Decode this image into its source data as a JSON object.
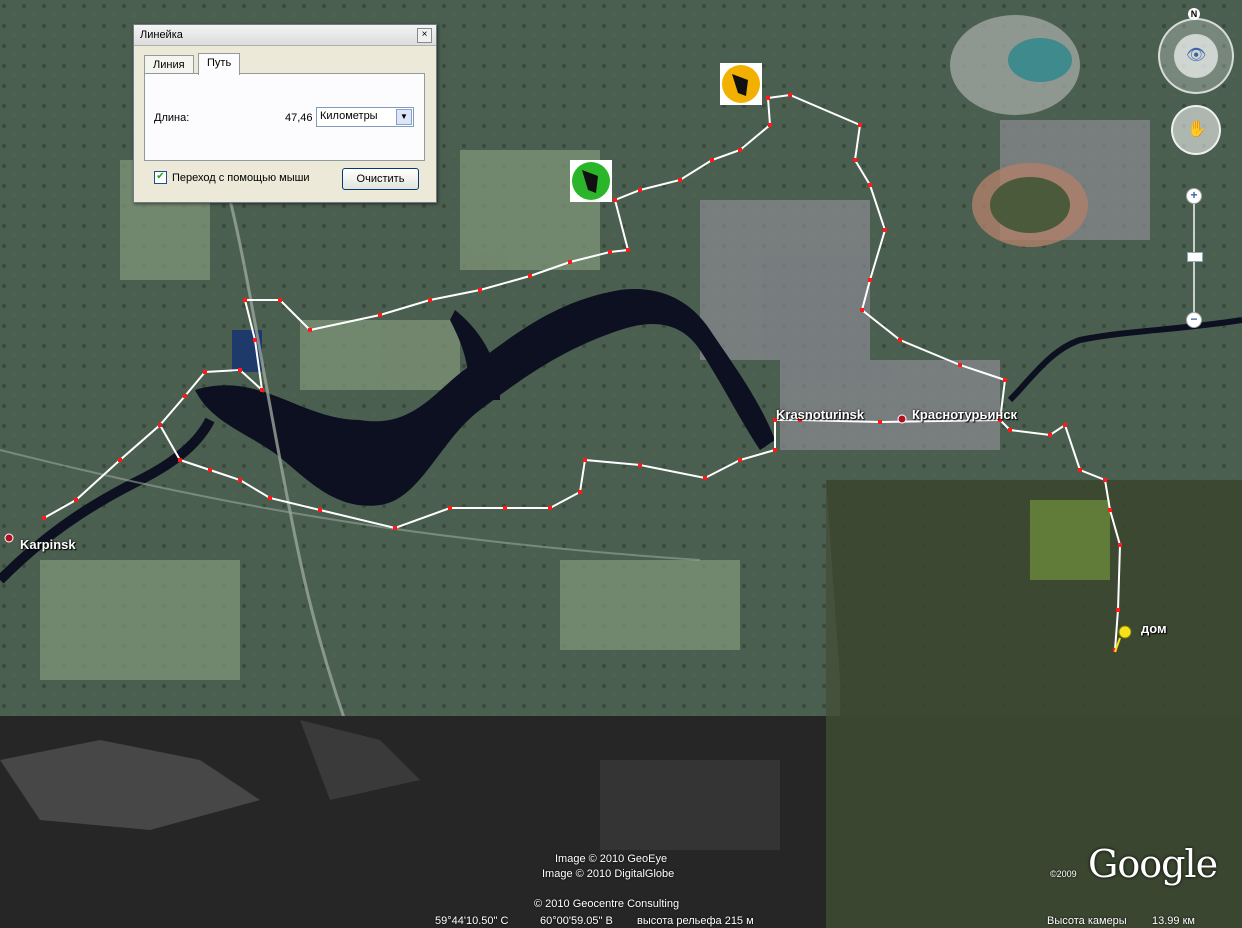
{
  "ruler": {
    "title": "Линейка",
    "close_glyph": "×",
    "tabs": [
      "Линия",
      "Путь"
    ],
    "active_tab": "Путь",
    "length_label": "Длина:",
    "length_value": "47,46",
    "unit_selected": "Километры",
    "mouse_nav_checked": true,
    "mouse_nav_label": "Переход с помощью мыши",
    "clear_button": "Очистить"
  },
  "places": {
    "karpinsk": "Karpinsk",
    "krasnoturinsk_en": "Krasnoturinsk",
    "krasnoturinsk_ru": "Краснотурьинск",
    "home": "дом"
  },
  "credits": {
    "line1": "Image © 2010 GeoEye",
    "line2": "Image © 2010 DigitalGlobe",
    "line3": "© 2010 Geocentre Consulting",
    "year": "©2009",
    "logo": "Google"
  },
  "status": {
    "lat": "59°44'10.50\" С",
    "lon": "60°00'59.05\" В",
    "elevation": "высота рельефа  215 м",
    "eye_label": "Высота камеры",
    "eye_value": "13.99 км"
  },
  "nav": {
    "north": "N",
    "zoom_in": "+",
    "zoom_out": "−"
  },
  "icons": [
    "look-icon",
    "move-hand-icon",
    "dog-club-marker-icon",
    "pushpin-icon",
    "place-dot-icon"
  ],
  "colors": {
    "path_line": "#ffffff",
    "path_points": "#ff1a1a",
    "water": "#0c1020",
    "forest": "#3e4b3a"
  }
}
